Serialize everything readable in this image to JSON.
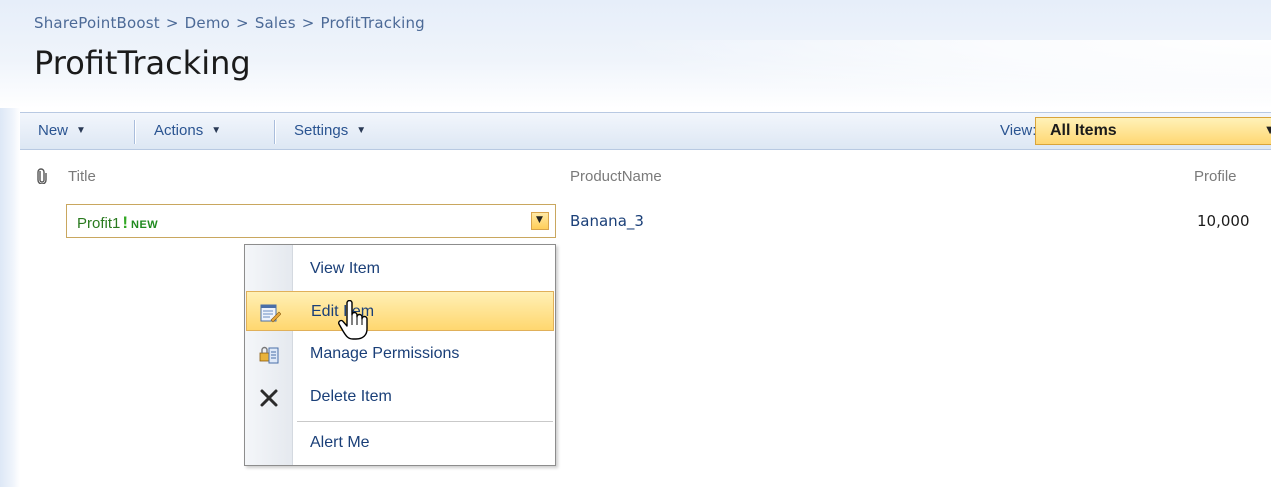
{
  "breadcrumb": [
    "SharePointBoost",
    "Demo",
    "Sales",
    "ProfitTracking"
  ],
  "breadcrumb_separator": ">",
  "page_title": "ProfitTracking",
  "toolbar": {
    "new_label": "New",
    "actions_label": "Actions",
    "settings_label": "Settings",
    "view_label": "View:",
    "view_value": "All Items"
  },
  "columns": {
    "title": "Title",
    "product": "ProductName",
    "profit": "Profile"
  },
  "row": {
    "title": "Profit1",
    "new_mark": "!",
    "new_tag": "NEW",
    "product": "Banana_3",
    "profit": "10,000"
  },
  "context_menu": {
    "items": [
      {
        "label": "View Item",
        "icon": "none"
      },
      {
        "label": "Edit Item",
        "icon": "edit-form-icon"
      },
      {
        "label": "Manage Permissions",
        "icon": "permissions-icon"
      },
      {
        "label": "Delete Item",
        "icon": "delete-x-icon"
      },
      {
        "label": "Alert Me",
        "icon": "none"
      }
    ],
    "highlighted_index": 1
  },
  "colors": {
    "link_blue": "#2a5491",
    "menu_text": "#1a3f78",
    "title_green": "#2a7a1f",
    "highlight_gold": "#ffd76f"
  }
}
